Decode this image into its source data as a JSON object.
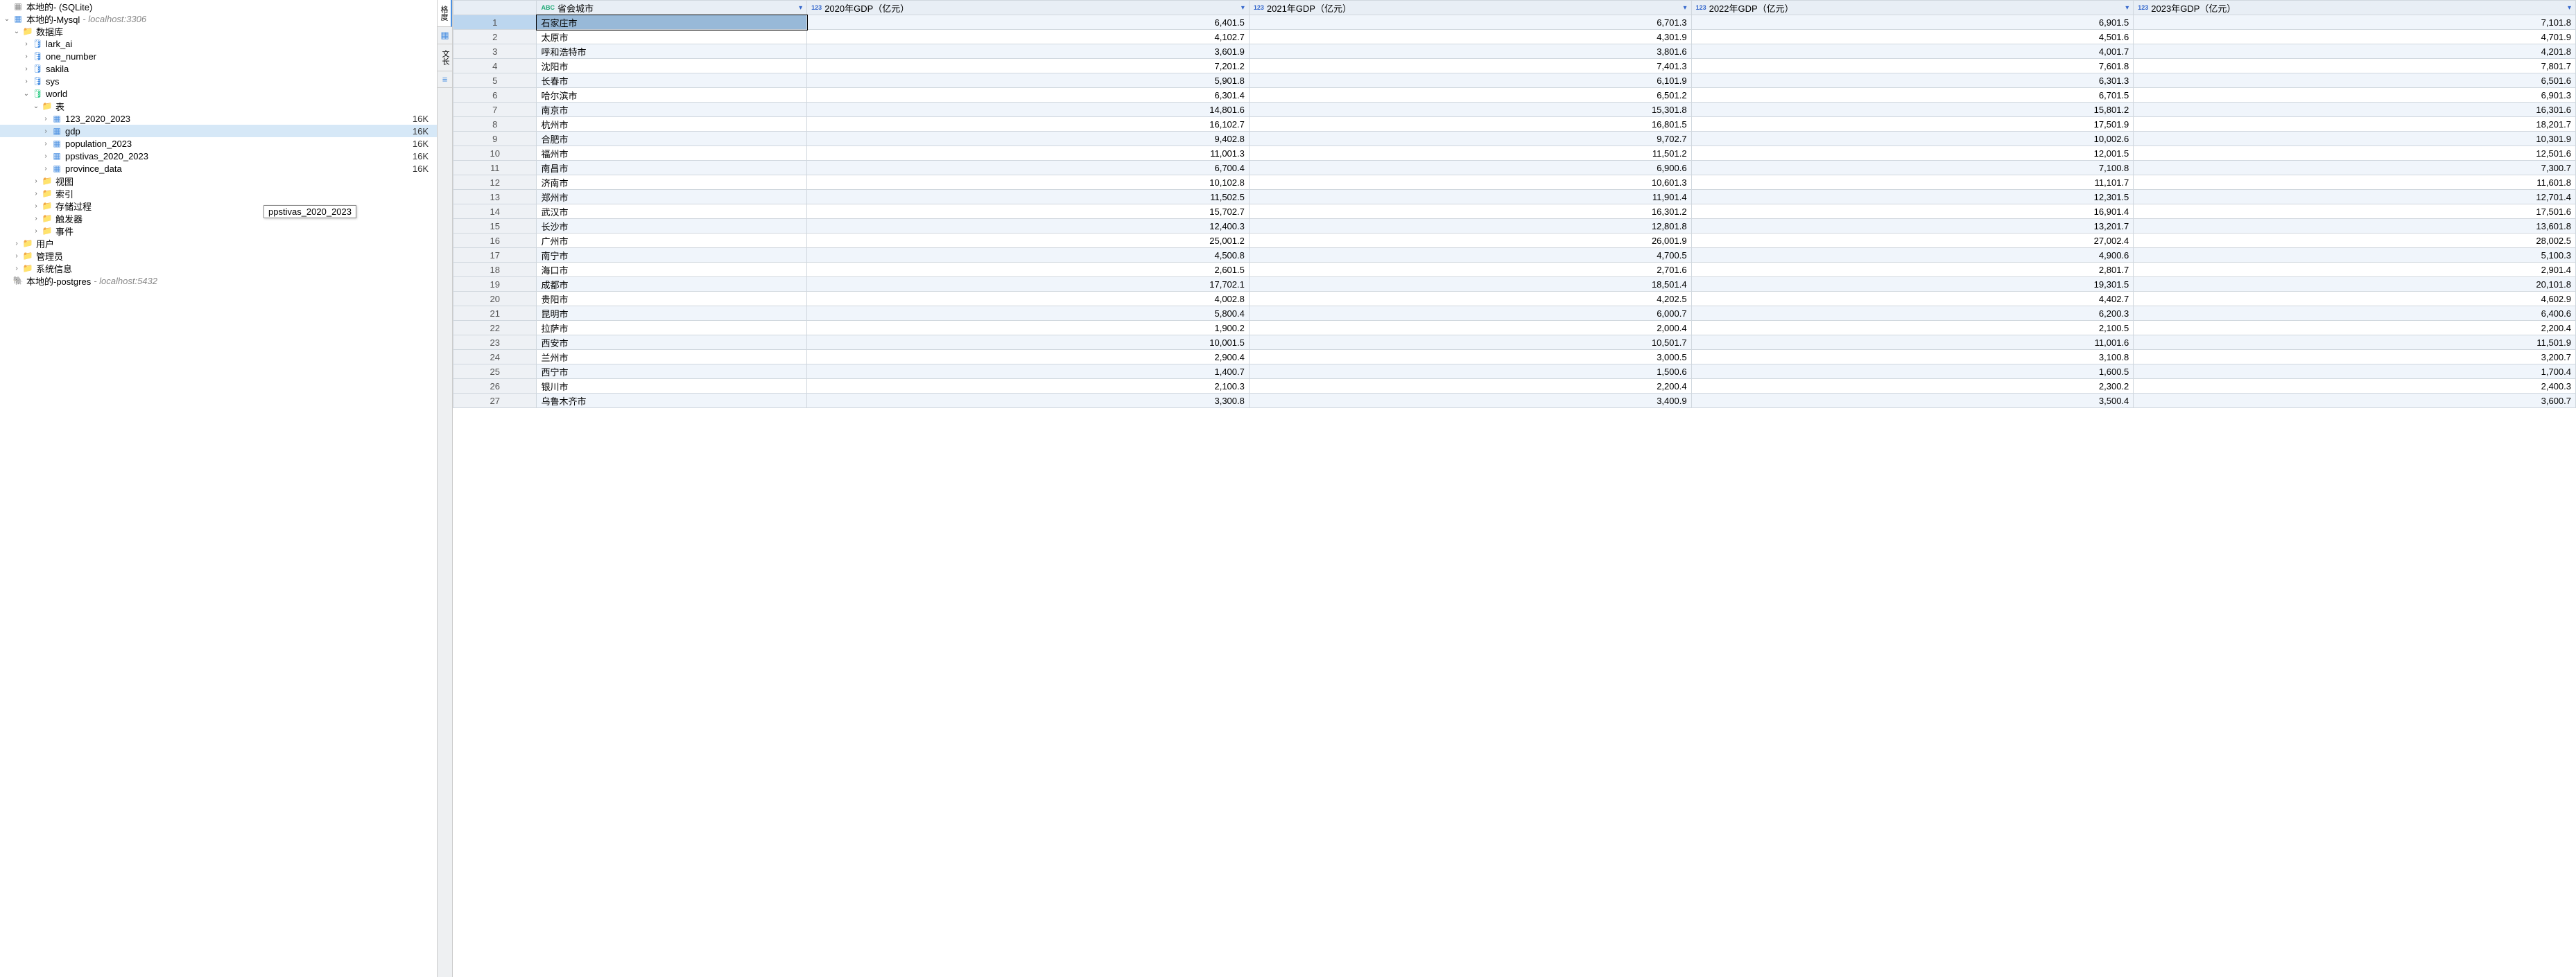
{
  "tree": {
    "conn_sqlite": {
      "label": "本地的- (SQLite)"
    },
    "conn_mysql": {
      "label": "本地的-Mysql",
      "host": "- localhost:3306"
    },
    "nodes": {
      "db_folder": "数据库",
      "lark_ai": "lark_ai",
      "one_number": "one_number",
      "sakila": "sakila",
      "sys": "sys",
      "world": "world",
      "tables": "表",
      "t1": "123_2020_2023",
      "t2": "gdp",
      "t3": "population_2023",
      "t4": "ppstivas_2020_2023",
      "t5": "province_data",
      "views": "视图",
      "indexes": "索引",
      "procs": "存储过程",
      "triggers": "触发器",
      "events": "事件",
      "users": "用户",
      "admins": "管理员",
      "sysinfo": "系统信息"
    },
    "sizes": {
      "t1": "16K",
      "t2": "16K",
      "t3": "16K",
      "t4": "16K",
      "t5": "16K"
    },
    "conn_pg": {
      "label": "本地的-postgres",
      "host": "- localhost:5432"
    },
    "tooltip": "ppstivas_2020_2023"
  },
  "verttabs": {
    "tab1": "格度",
    "tab2": "文长"
  },
  "grid": {
    "columns": [
      {
        "type": "ABC",
        "name": "省会城市"
      },
      {
        "type": "123",
        "name": "2020年GDP（亿元）"
      },
      {
        "type": "123",
        "name": "2021年GDP（亿元）"
      },
      {
        "type": "123",
        "name": "2022年GDP（亿元）"
      },
      {
        "type": "123",
        "name": "2023年GDP（亿元）"
      }
    ],
    "rows": [
      {
        "n": "1",
        "city": "石家庄市",
        "g": [
          "6,401.5",
          "6,701.3",
          "6,901.5",
          "7,101.8"
        ]
      },
      {
        "n": "2",
        "city": "太原市",
        "g": [
          "4,102.7",
          "4,301.9",
          "4,501.6",
          "4,701.9"
        ]
      },
      {
        "n": "3",
        "city": "呼和浩特市",
        "g": [
          "3,601.9",
          "3,801.6",
          "4,001.7",
          "4,201.8"
        ]
      },
      {
        "n": "4",
        "city": "沈阳市",
        "g": [
          "7,201.2",
          "7,401.3",
          "7,601.8",
          "7,801.7"
        ]
      },
      {
        "n": "5",
        "city": "长春市",
        "g": [
          "5,901.8",
          "6,101.9",
          "6,301.3",
          "6,501.6"
        ]
      },
      {
        "n": "6",
        "city": "哈尔滨市",
        "g": [
          "6,301.4",
          "6,501.2",
          "6,701.5",
          "6,901.3"
        ]
      },
      {
        "n": "7",
        "city": "南京市",
        "g": [
          "14,801.6",
          "15,301.8",
          "15,801.2",
          "16,301.6"
        ]
      },
      {
        "n": "8",
        "city": "杭州市",
        "g": [
          "16,102.7",
          "16,801.5",
          "17,501.9",
          "18,201.7"
        ]
      },
      {
        "n": "9",
        "city": "合肥市",
        "g": [
          "9,402.8",
          "9,702.7",
          "10,002.6",
          "10,301.9"
        ]
      },
      {
        "n": "10",
        "city": "福州市",
        "g": [
          "11,001.3",
          "11,501.2",
          "12,001.5",
          "12,501.6"
        ]
      },
      {
        "n": "11",
        "city": "南昌市",
        "g": [
          "6,700.4",
          "6,900.6",
          "7,100.8",
          "7,300.7"
        ]
      },
      {
        "n": "12",
        "city": "济南市",
        "g": [
          "10,102.8",
          "10,601.3",
          "11,101.7",
          "11,601.8"
        ]
      },
      {
        "n": "13",
        "city": "郑州市",
        "g": [
          "11,502.5",
          "11,901.4",
          "12,301.5",
          "12,701.4"
        ]
      },
      {
        "n": "14",
        "city": "武汉市",
        "g": [
          "15,702.7",
          "16,301.2",
          "16,901.4",
          "17,501.6"
        ]
      },
      {
        "n": "15",
        "city": "长沙市",
        "g": [
          "12,400.3",
          "12,801.8",
          "13,201.7",
          "13,601.8"
        ]
      },
      {
        "n": "16",
        "city": "广州市",
        "g": [
          "25,001.2",
          "26,001.9",
          "27,002.4",
          "28,002.5"
        ]
      },
      {
        "n": "17",
        "city": "南宁市",
        "g": [
          "4,500.8",
          "4,700.5",
          "4,900.6",
          "5,100.3"
        ]
      },
      {
        "n": "18",
        "city": "海口市",
        "g": [
          "2,601.5",
          "2,701.6",
          "2,801.7",
          "2,901.4"
        ]
      },
      {
        "n": "19",
        "city": "成都市",
        "g": [
          "17,702.1",
          "18,501.4",
          "19,301.5",
          "20,101.8"
        ]
      },
      {
        "n": "20",
        "city": "贵阳市",
        "g": [
          "4,002.8",
          "4,202.5",
          "4,402.7",
          "4,602.9"
        ]
      },
      {
        "n": "21",
        "city": "昆明市",
        "g": [
          "5,800.4",
          "6,000.7",
          "6,200.3",
          "6,400.6"
        ]
      },
      {
        "n": "22",
        "city": "拉萨市",
        "g": [
          "1,900.2",
          "2,000.4",
          "2,100.5",
          "2,200.4"
        ]
      },
      {
        "n": "23",
        "city": "西安市",
        "g": [
          "10,001.5",
          "10,501.7",
          "11,001.6",
          "11,501.9"
        ]
      },
      {
        "n": "24",
        "city": "兰州市",
        "g": [
          "2,900.4",
          "3,000.5",
          "3,100.8",
          "3,200.7"
        ]
      },
      {
        "n": "25",
        "city": "西宁市",
        "g": [
          "1,400.7",
          "1,500.6",
          "1,600.5",
          "1,700.4"
        ]
      },
      {
        "n": "26",
        "city": "银川市",
        "g": [
          "2,100.3",
          "2,200.4",
          "2,300.2",
          "2,400.3"
        ]
      },
      {
        "n": "27",
        "city": "乌鲁木齐市",
        "g": [
          "3,300.8",
          "3,400.9",
          "3,500.4",
          "3,600.7"
        ]
      }
    ]
  }
}
